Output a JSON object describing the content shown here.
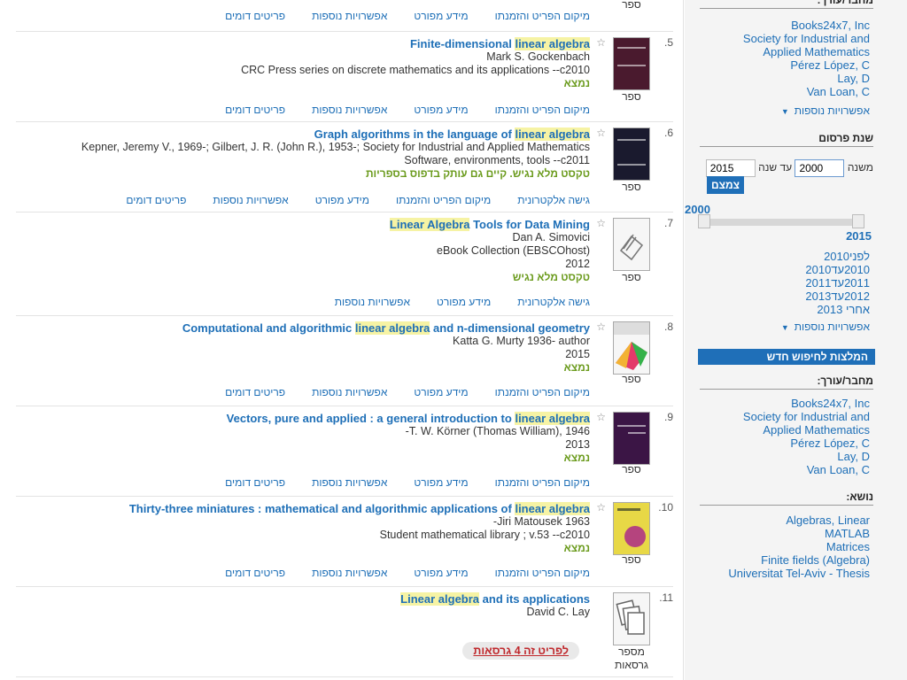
{
  "item_type_book": "ספר",
  "link_labels": {
    "location": "מיקום הפריט והזמנתו",
    "details": "מידע מפורט",
    "more_options": "אפשרויות נוספות",
    "similar": "פריטים דומים",
    "electronic": "גישה אלקטרונית"
  },
  "results": [
    {
      "number": "5.",
      "title_pre": "Finite-dimensional ",
      "title_hl": "linear algebra",
      "title_post": "",
      "lines": [
        "Mark S. Gockenbach",
        "CRC Press series on discrete mathematics and its applications --c2010"
      ],
      "availability": "נמצא"
    },
    {
      "number": "6.",
      "title_pre": "Graph algorithms in the language of ",
      "title_hl": "linear algebra",
      "title_post": "",
      "lines": [
        "Kepner, Jeremy V., 1969-; Gilbert, J. R. (John R.), 1953-; Society for Industrial and Applied Mathematics",
        "Software, environments, tools --c2011"
      ],
      "availability": "טקסט מלא נגיש. קיים גם עותק בדפוס בספריות"
    },
    {
      "number": "7.",
      "title_pre": "Linear Algebra",
      "title_hl": "",
      "title_post": " Tools for Data Mining",
      "lines": [
        "Dan A. Simovici",
        "eBook Collection (EBSCOhost)",
        "2012"
      ],
      "availability": "טקסט מלא נגיש"
    },
    {
      "number": "8.",
      "title_pre": "Computational and algorithmic ",
      "title_hl": "linear algebra",
      "title_post": " and n-dimensional geometry",
      "lines": [
        "Katta G. Murty 1936- author",
        "2015"
      ],
      "availability": "נמצא"
    },
    {
      "number": "9.",
      "title_pre": "Vectors, pure and applied : a general introduction to ",
      "title_hl": "linear algebra",
      "title_post": "",
      "lines": [
        "T. W. Körner (Thomas William), 1946-",
        "2013"
      ],
      "availability": "נמצא"
    },
    {
      "number": "10.",
      "title_pre": "Thirty-three miniatures : mathematical and algorithmic applications of ",
      "title_hl": "linear algebra",
      "title_post": "",
      "lines": [
        "Jiri Matousek 1963-",
        "Student mathematical library ; v.53 --c2010"
      ],
      "availability": "נמצא"
    },
    {
      "number": "11.",
      "title_pre": "Linear algebra",
      "title_hl": "",
      "title_post": " and its applications",
      "lines": [
        "David C. Lay"
      ],
      "availability": ""
    }
  ],
  "item11": {
    "type_label": "מספר גרסאות",
    "versions_link": "לפריט זה 4 גרסאות"
  },
  "sidebar": {
    "author_header": "מחבר/עורך:",
    "authors": [
      "Books24x7, Inc",
      "Society for Industrial and",
      "Applied Mathematics",
      "Pérez López, C",
      "Lay, D",
      "Van Loan, C"
    ],
    "more_options": "אפשרויות נוספות",
    "pub_year_header": "שנת פרסום",
    "from_label": "משנה",
    "to_label": "עד שנה",
    "from_value": "2000",
    "to_value": "2015",
    "submit_label": "צמצם",
    "slider_min": "2000",
    "slider_max": "2015",
    "year_links": [
      "לפני2010",
      "2010עד2010",
      "2011עד2011",
      "2012עד2013",
      "אחרי 2013"
    ],
    "recommend_banner": "המלצות לחיפוש חדש",
    "author_header2": "מחבר/עורך:",
    "authors2": [
      "Books24x7, Inc",
      "Society for Industrial and",
      "Applied Mathematics",
      "Pérez López, C",
      "Lay, D",
      "Van Loan, C"
    ],
    "subject_header": "נושא:",
    "subjects": [
      "Algebras, Linear",
      "MATLAB",
      "Matrices",
      "Finite fields (Algebra)",
      "Universitat Tel-Aviv - Thesis"
    ]
  }
}
